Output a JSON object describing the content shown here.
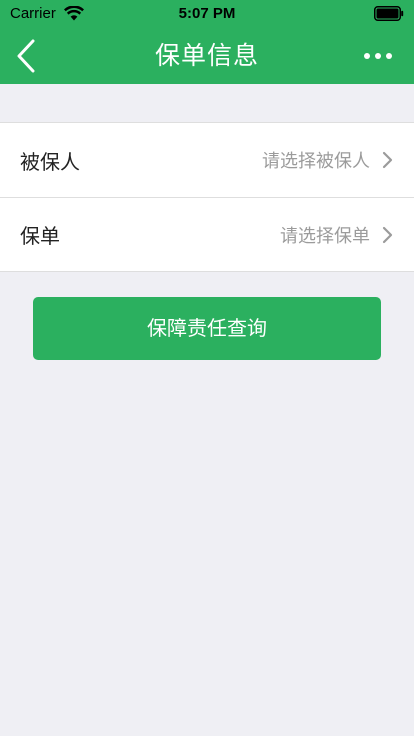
{
  "colors": {
    "primary": "#2bb05f",
    "background": "#efeff4",
    "text": "#222222",
    "placeholder": "#9b9b9b",
    "divider": "#dedede"
  },
  "status_bar": {
    "carrier": "Carrier",
    "time": "5:07 PM",
    "icons": [
      "wifi-icon",
      "battery-icon"
    ]
  },
  "nav_bar": {
    "title": "保单信息",
    "back_icon": "chevron-left-icon",
    "more_icon": "more-horizontal-icon"
  },
  "list": {
    "items": [
      {
        "label": "被保人",
        "placeholder": "请选择被保人"
      },
      {
        "label": "保单",
        "placeholder": "请选择保单"
      }
    ]
  },
  "actions": {
    "primary_label": "保障责任查询"
  }
}
